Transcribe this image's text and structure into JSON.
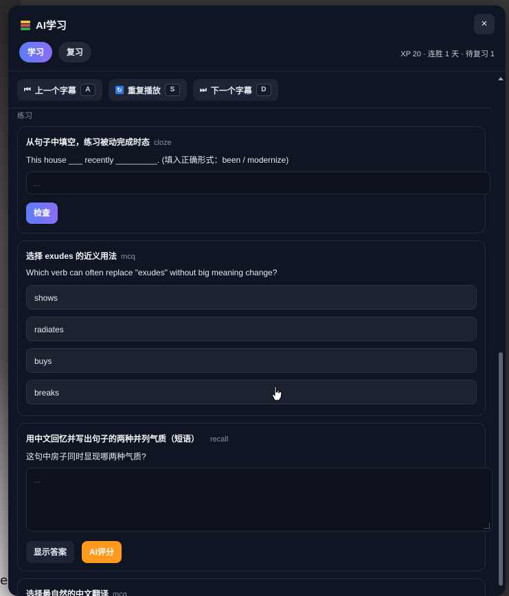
{
  "header": {
    "title": "AI学习",
    "close_label": "×",
    "tabs": [
      {
        "label": "学习",
        "active": true
      },
      {
        "label": "复习",
        "active": false
      }
    ],
    "stats": "XP 20 · 连胜 1 天 · 待复习 1"
  },
  "nav": {
    "prev": {
      "label": "上一个字幕",
      "key": "A",
      "icon": "⏮"
    },
    "replay": {
      "label": "重复播放",
      "key": "S",
      "icon": "🔁"
    },
    "next": {
      "label": "下一个字幕",
      "key": "D",
      "icon": "⏭"
    }
  },
  "section_label": "练习",
  "exercises": [
    {
      "title": "从句子中填空，练习被动完成时态",
      "type": "cloze",
      "question": "This house ___ recently _________. (填入正确形式：been / modernize)",
      "input_placeholder": "...",
      "check_label": "检查"
    },
    {
      "title": "选择 exudes 的近义用法",
      "type": "mcq",
      "question": "Which verb can often replace \"exudes\" without big meaning change?",
      "options": [
        "shows",
        "radiates",
        "buys",
        "breaks"
      ]
    },
    {
      "title": "用中文回忆并写出句子的两种并列气质（短语）",
      "type": "recall",
      "question": "这句中房子同时显现哪两种气质?",
      "textarea_placeholder": "...",
      "show_answer_label": "显示答案",
      "ai_grade_label": "AI评分"
    },
    {
      "title": "选择最自然的中文翻译",
      "type": "mcq"
    }
  ],
  "background_letter": "e",
  "colors": {
    "panel_bg": "#0f1522",
    "accent_gradient_start": "#5a7df7",
    "accent_gradient_end": "#8b6df2",
    "orange": "#ff9a1f"
  }
}
